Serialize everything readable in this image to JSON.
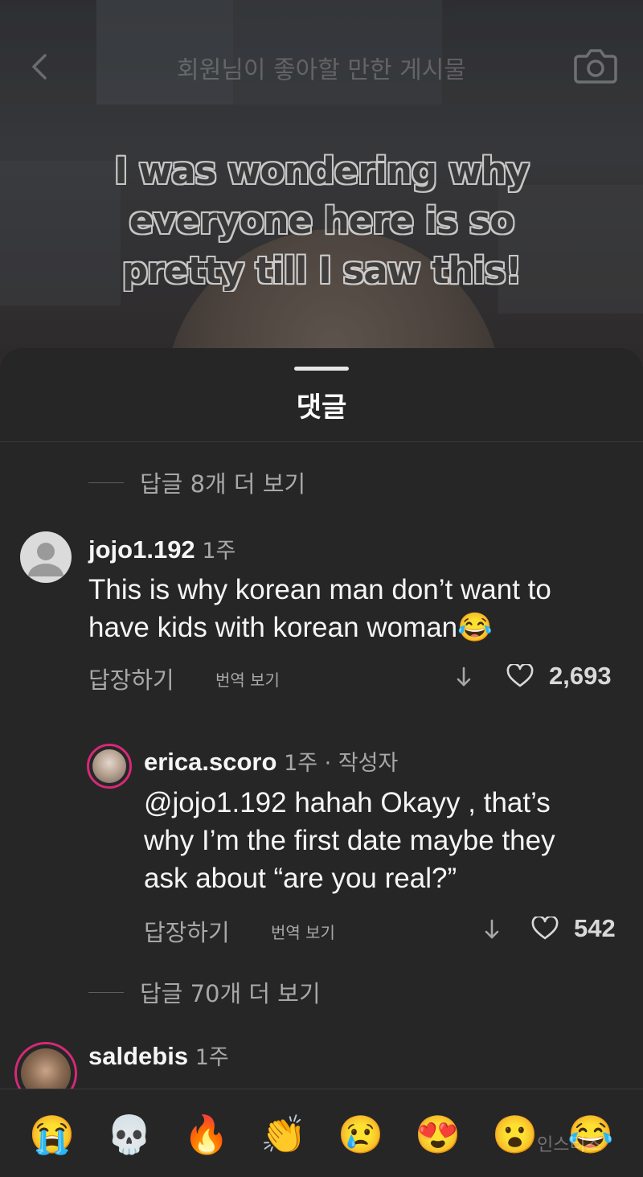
{
  "header": {
    "title": "회원님이 좋아할 만한 게시물",
    "back_icon": "chevron-left-icon",
    "camera_icon": "camera-icon"
  },
  "video": {
    "caption_lines": [
      "I was wondering why",
      "everyone here is so",
      "pretty till I saw this!"
    ]
  },
  "sheet": {
    "title": "댓글",
    "view_more_top": "답글 8개 더 보기",
    "view_more_bottom": "답글 70개 더 보기"
  },
  "comments": [
    {
      "username": "jojo1.192",
      "time": "1주",
      "text_lines": [
        "This is why korean man don’t want to",
        "have kids with korean woman😂"
      ],
      "reply_label": "답장하기",
      "translate_label": "번역 보기",
      "likes": "2,693"
    },
    {
      "username": "erica.scoro",
      "time": "1주 · 작성자",
      "text_lines": [
        "@jojo1.192 hahah Okayy , that’s",
        "why I’m the first date maybe they",
        "ask about “are you real?”"
      ],
      "reply_label": "답장하기",
      "translate_label": "번역 보기",
      "likes": "542"
    },
    {
      "username": "saldebis",
      "time": "1주"
    }
  ],
  "emoji_bar": [
    "😭",
    "💀",
    "🔥",
    "👏",
    "😢",
    "😍",
    "😮",
    "😂"
  ],
  "watermark": "인스티즈",
  "colors": {
    "background": "#262626",
    "text_primary": "#f5f5f5",
    "text_secondary": "#a8a8a8",
    "story_ring": "#d62976"
  }
}
